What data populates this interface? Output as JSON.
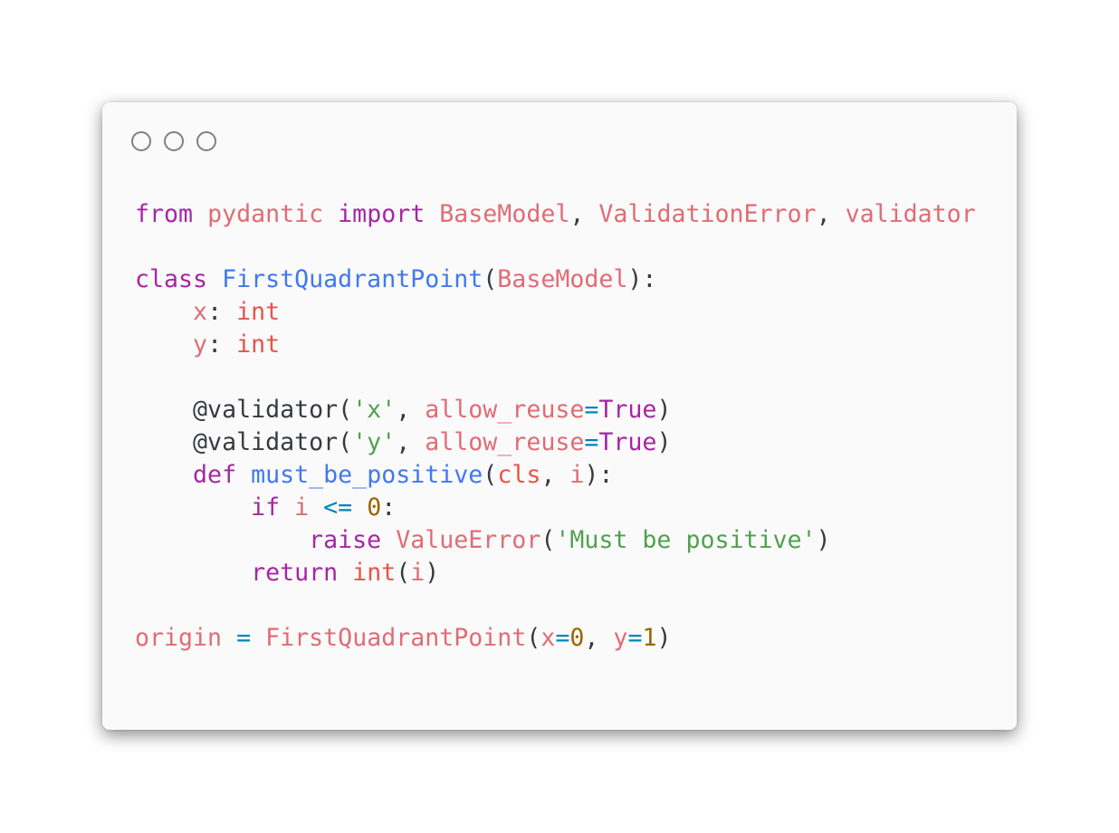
{
  "window": {
    "controls": [
      "close-icon",
      "minimize-icon",
      "maximize-icon"
    ]
  },
  "colors": {
    "background": "#fafafa",
    "keyword": "#a626a4",
    "name": "#e06c75",
    "type": "#e45649",
    "function": "#4078f2",
    "string": "#50a14f",
    "operator": "#0184bc",
    "number": "#986801",
    "plain": "#383a42"
  },
  "code": {
    "l1": {
      "t1": "from",
      "t2": " ",
      "t3": "pydantic",
      "t4": " ",
      "t5": "import",
      "t6": " ",
      "t7": "BaseModel",
      "t8": ", ",
      "t9": "ValidationError",
      "t10": ", ",
      "t11": "validator"
    },
    "l3": {
      "t1": "class",
      "t2": " ",
      "t3": "FirstQuadrantPoint",
      "t4": "(",
      "t5": "BaseModel",
      "t6": "):"
    },
    "l4": {
      "t1": "    ",
      "t2": "x",
      "t3": ": ",
      "t4": "int"
    },
    "l5": {
      "t1": "    ",
      "t2": "y",
      "t3": ": ",
      "t4": "int"
    },
    "l7": {
      "t1": "    @validator(",
      "t2": "'x'",
      "t3": ", ",
      "t4": "allow_reuse",
      "t5": "=",
      "t6": "True",
      "t7": ")"
    },
    "l8": {
      "t1": "    @validator(",
      "t2": "'y'",
      "t3": ", ",
      "t4": "allow_reuse",
      "t5": "=",
      "t6": "True",
      "t7": ")"
    },
    "l9": {
      "t1": "    ",
      "t2": "def",
      "t3": " ",
      "t4": "must_be_positive",
      "t5": "(",
      "t6": "cls",
      "t7": ", ",
      "t8": "i",
      "t9": "):"
    },
    "l10": {
      "t1": "        ",
      "t2": "if",
      "t3": " ",
      "t4": "i",
      "t5": " ",
      "t6": "<=",
      "t7": " ",
      "t8": "0",
      "t9": ":"
    },
    "l11": {
      "t1": "            ",
      "t2": "raise",
      "t3": " ",
      "t4": "ValueError",
      "t5": "(",
      "t6": "'Must be positive'",
      "t7": ")"
    },
    "l12": {
      "t1": "        ",
      "t2": "return",
      "t3": " ",
      "t4": "int",
      "t5": "(",
      "t6": "i",
      "t7": ")"
    },
    "l14": {
      "t1": "origin",
      "t2": " ",
      "t3": "=",
      "t4": " ",
      "t5": "FirstQuadrantPoint",
      "t6": "(",
      "t7": "x",
      "t8": "=",
      "t9": "0",
      "t10": ", ",
      "t11": "y",
      "t12": "=",
      "t13": "1",
      "t14": ")"
    }
  }
}
